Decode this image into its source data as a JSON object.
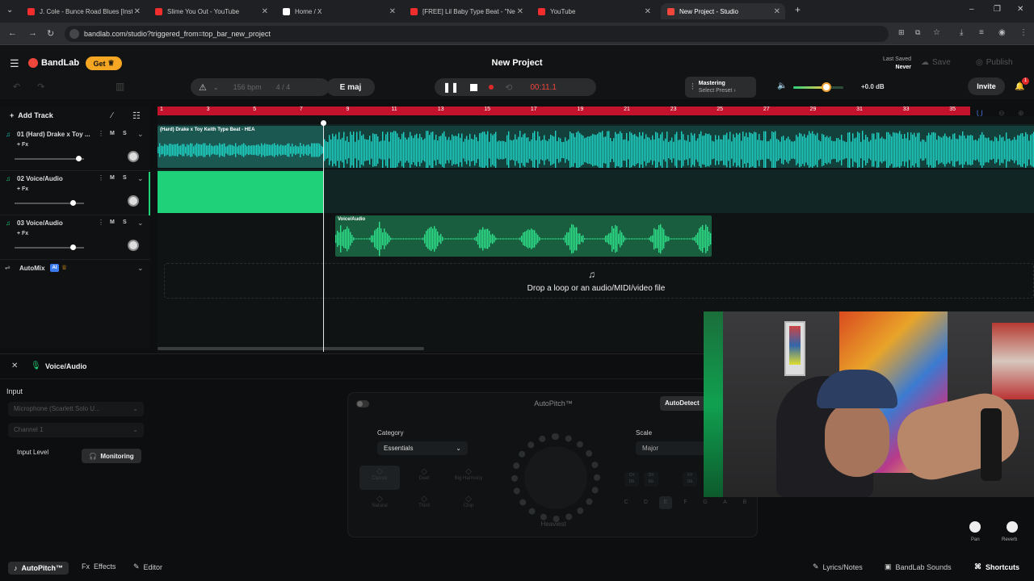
{
  "browser": {
    "tabs": [
      {
        "title": "J. Cole - Bunce Road Blues [Inst",
        "color": "#f12d2d"
      },
      {
        "title": "Slime You Out - YouTube",
        "color": "#f12d2d"
      },
      {
        "title": "Home / X",
        "color": "#ffffff"
      },
      {
        "title": "[FREE] Lil Baby Type Beat - \"Ne",
        "color": "#f12d2d"
      },
      {
        "title": "YouTube",
        "color": "#f12d2d"
      },
      {
        "title": "New Project - Studio",
        "color": "#f0463c"
      }
    ],
    "url": "bandlab.com/studio?triggered_from=top_bar_new_project"
  },
  "app": {
    "brand": "BandLab",
    "get_label": "Get",
    "project_title": "New Project",
    "last_saved_label": "Last Saved",
    "last_saved_value": "Never",
    "save_label": "Save",
    "publish_label": "Publish",
    "invite_label": "Invite",
    "notification_count": "1"
  },
  "transport": {
    "bpm_value": "156",
    "bpm_unit": "bpm",
    "time_sig": "4 / 4",
    "key": "E maj",
    "time": "00:11.1",
    "mastering_label": "Mastering",
    "mastering_preset": "Select Preset",
    "master_volume_db": "+0.0 dB",
    "master_volume_level": 0.66
  },
  "tracklist": {
    "add_track_label": "Add Track",
    "mute_label": "M",
    "solo_label": "S",
    "fx_label": "+ Fx",
    "tracks": [
      {
        "name": "01  (Hard) Drake x Toy ...",
        "volume": 0.92,
        "color": "#17cdb4"
      },
      {
        "name": "02  Voice/Audio",
        "volume": 0.84,
        "color": "#1fd27a"
      },
      {
        "name": "03  Voice/Audio",
        "volume": 0.84,
        "color": "#1fd27a"
      }
    ],
    "automix_label": "AutoMix",
    "automix_badge": "AI"
  },
  "timeline": {
    "bars": [
      "1",
      "3",
      "5",
      "7",
      "9",
      "11",
      "13",
      "15",
      "17",
      "19",
      "21",
      "23",
      "25",
      "27",
      "29",
      "31",
      "33",
      "35"
    ],
    "clip1_label": "(Hard) Drake x Toy Keith Type Beat - HEA",
    "clip3_label": "Voice/Audio",
    "drop_hint": "Drop a loop or an audio/MIDI/video file"
  },
  "panel": {
    "track_title": "Voice/Audio",
    "input_label": "Input",
    "input_device": "Microphone (Scarlett Solo U...",
    "channel": "Channel 1",
    "input_level_label": "Input Level",
    "monitoring_label": "Monitoring",
    "autopitch_title": "AutoPitch™",
    "autodetect_label": "AutoDetect",
    "category_label": "Category",
    "category_value": "Essentials",
    "scale_label": "Scale",
    "scale_value": "Major",
    "presets": [
      "Classic",
      "Duet",
      "Big Harmony",
      "Natural",
      "Third",
      "Chip"
    ],
    "knob_label": "Heaviest",
    "notes": [
      "C",
      "D",
      "E",
      "F",
      "G",
      "A",
      "B"
    ],
    "sharps": [
      "C#\nDb",
      "D#\nEb",
      "F#\nGb"
    ],
    "pan_label": "Pan",
    "reverb_label": "Reverb"
  },
  "bottom": {
    "autopitch_label": "AutoPitch™",
    "effects_label": "Effects",
    "editor_label": "Editor",
    "lyrics_label": "Lyrics/Notes",
    "sounds_label": "BandLab Sounds",
    "shortcuts_label": "Shortcuts"
  }
}
